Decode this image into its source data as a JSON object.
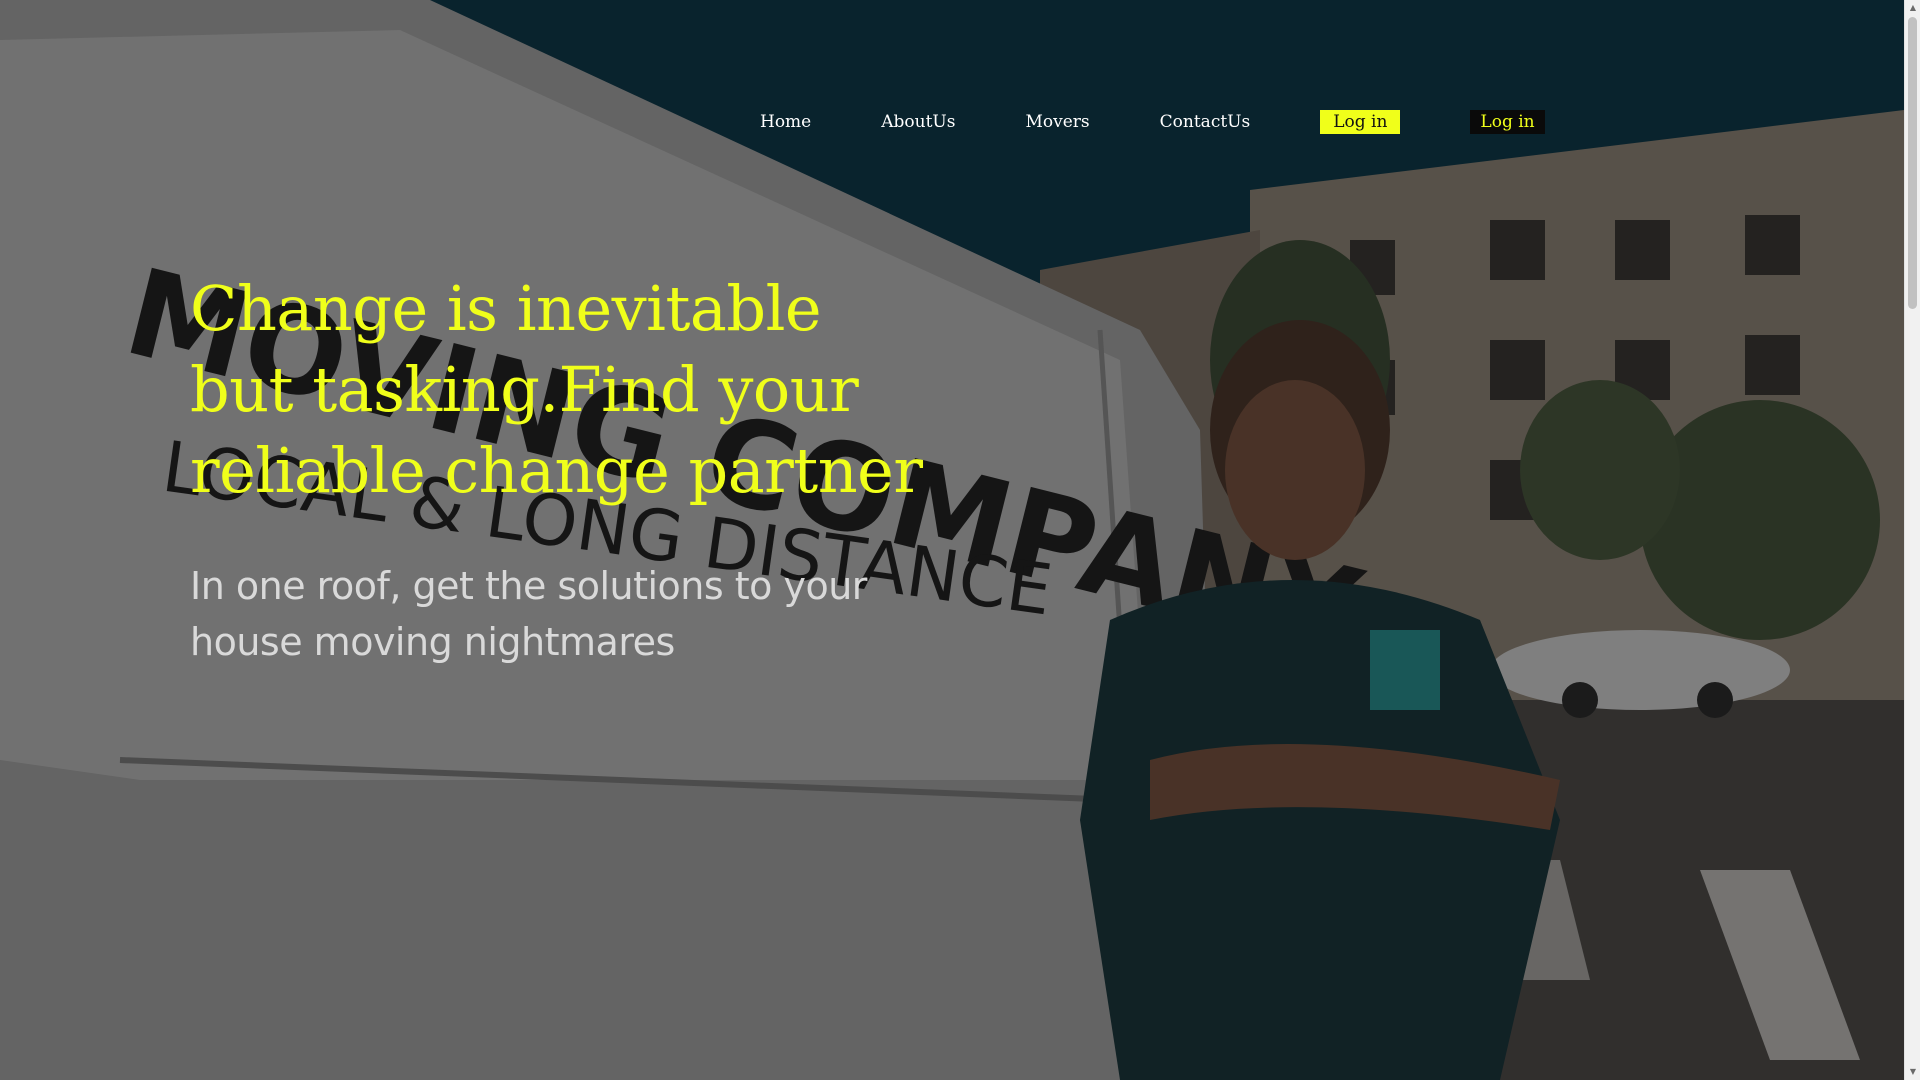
{
  "nav": {
    "links": [
      "Home",
      "AboutUs",
      "Movers",
      "ContactUs"
    ],
    "login_primary": "Log in",
    "login_secondary": "Log in"
  },
  "hero": {
    "headline": "Change is inevitable but tasking.Find your reliable change partner",
    "subheadline": "In one roof, get the solutions to your house moving nightmares",
    "van_lettering": "MOVING COMPANY LOCAL & LONG DISTANCE"
  },
  "colors": {
    "accent": "#f0ff1a",
    "nav_text": "#ffffff",
    "sub_text": "#d9d9d9",
    "dark_button": "#0a0a0a"
  },
  "icons": {
    "scroll_up": "triangle-up-icon",
    "scroll_down": "triangle-down-icon"
  }
}
